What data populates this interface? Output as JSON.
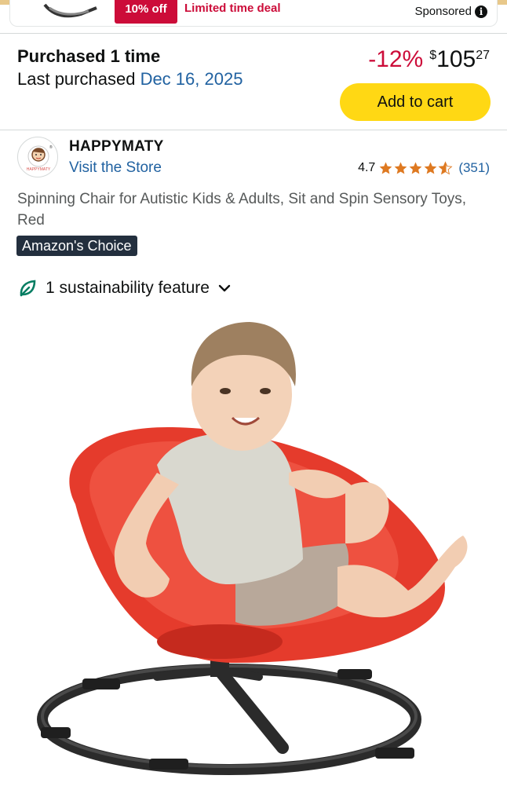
{
  "sponsored_strip": {
    "deal_badge": "10% off",
    "deal_text": "Limited time deal",
    "sponsored_label": "Sponsored",
    "info_icon": "info-icon"
  },
  "purchase_history": {
    "count_text": "Purchased 1 time",
    "last_purchased_label": "Last purchased",
    "last_purchased_date": "Dec 16, 2025"
  },
  "price": {
    "discount": "-12%",
    "currency": "$",
    "whole": "105",
    "fraction": "27"
  },
  "add_to_cart_label": "Add to cart",
  "brand": {
    "name": "HAPPYMATY",
    "logo_text": "HAPPYMATY",
    "visit_store": "Visit the Store"
  },
  "rating": {
    "value": "4.7",
    "stars": 4.7,
    "count": "(351)"
  },
  "product_title": "Spinning Chair for Autistic Kids & Adults, Sit and Spin Sensory Toys, Red",
  "badge": "Amazon's Choice",
  "sustainability": {
    "label": "1 sustainability feature",
    "icon": "leaf-icon"
  },
  "colors": {
    "price_red": "#cc0c39",
    "link_blue": "#2162a1",
    "cart_yellow": "#ffd814",
    "star_orange": "#de7921",
    "badge_navy": "#232f3e",
    "leaf_green": "#067d62",
    "chair_red": "#e53b2c"
  }
}
